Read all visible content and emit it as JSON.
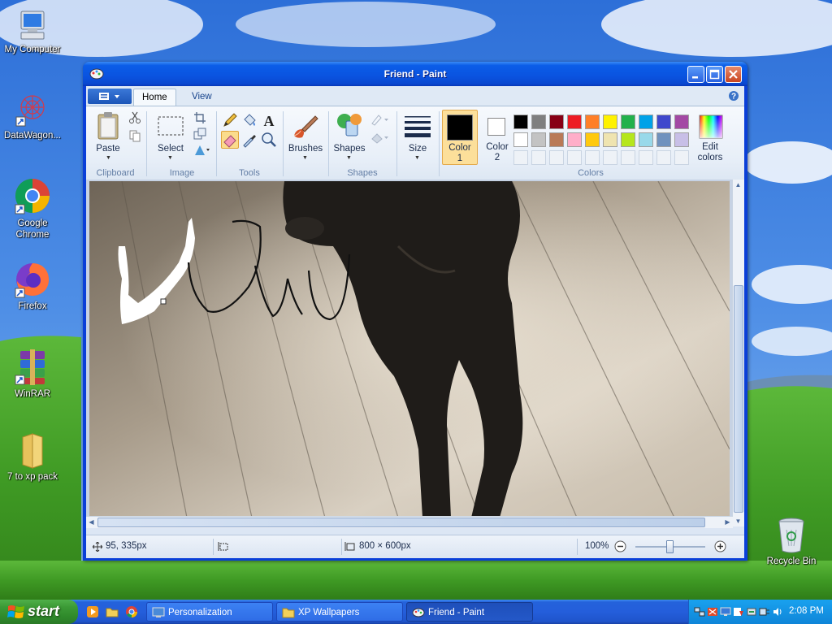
{
  "desktop": {
    "icons": [
      {
        "label": "My Computer"
      },
      {
        "label": "DataWagon..."
      },
      {
        "label": "Google Chrome"
      },
      {
        "label": "Firefox"
      },
      {
        "label": "WinRAR"
      },
      {
        "label": "7 to xp pack"
      },
      {
        "label": "Recycle Bin"
      }
    ]
  },
  "window": {
    "title": "Friend - Paint",
    "tabs": [
      {
        "label": "Home"
      },
      {
        "label": "View"
      }
    ],
    "groups": {
      "clipboard": "Clipboard",
      "image": "Image",
      "tools": "Tools",
      "shapes": "Shapes",
      "colors": "Colors"
    },
    "buttons": {
      "paste": "Paste",
      "select": "Select",
      "brushes": "Brushes",
      "shapes": "Shapes",
      "size": "Size",
      "color1_line1": "Color",
      "color1_line2": "1",
      "color2_line1": "Color",
      "color2_line2": "2",
      "edit_colors_line1": "Edit",
      "edit_colors_line2": "colors"
    },
    "color1": "#000000",
    "color2": "#ffffff",
    "palette": [
      "#000000",
      "#7f7f7f",
      "#880015",
      "#ed1c24",
      "#ff7f27",
      "#fff200",
      "#22b14c",
      "#00a2e8",
      "#3f48cc",
      "#a349a4",
      "#ffffff",
      "#c3c3c3",
      "#b97a57",
      "#ffaec9",
      "#ffc90e",
      "#efe4b0",
      "#b5e61d",
      "#99d9ea",
      "#7092be",
      "#c8bfe7"
    ],
    "status": {
      "cursor_pos": "95, 335px",
      "image_size": "800 × 600px",
      "zoom": "100%"
    }
  },
  "taskbar": {
    "start_label": "start",
    "tasks": [
      {
        "label": "Personalization"
      },
      {
        "label": "XP Wallpapers"
      },
      {
        "label": "Friend - Paint"
      }
    ],
    "clock": "2:08 PM"
  }
}
